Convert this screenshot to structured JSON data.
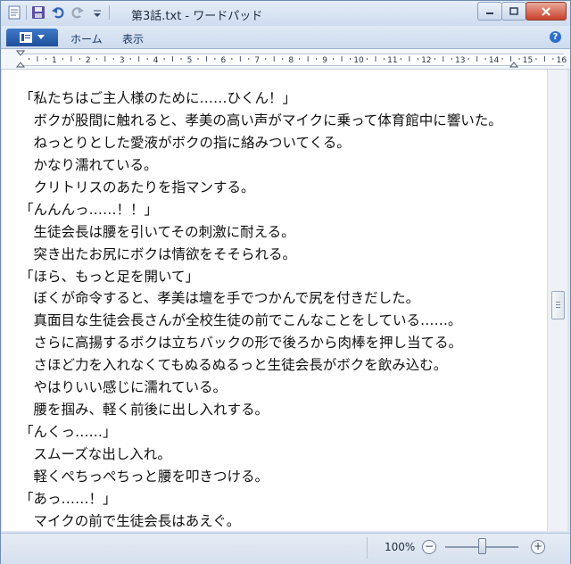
{
  "window": {
    "title": "第3話.txt - ワードパッド"
  },
  "ribbon": {
    "tabs": [
      {
        "label": "ホーム"
      },
      {
        "label": "表示"
      }
    ],
    "help": "?"
  },
  "ruler": {
    "labels": [
      "1",
      "2",
      "3",
      "4",
      "5",
      "6",
      "7",
      "8",
      "9",
      "10",
      "11",
      "12",
      "13",
      "14",
      "15",
      "16"
    ]
  },
  "document": {
    "lines": [
      "「私たちはご主人様のために……ひくん！」",
      "　ボクが股間に触れると、孝美の高い声がマイクに乗って体育館中に響いた。",
      "　ねっとりとした愛液がボクの指に絡みついてくる。",
      "　かなり濡れている。",
      "　クリトリスのあたりを指マンする。",
      "「んんんっ……！！」",
      "　生徒会長は腰を引いてその刺激に耐える。",
      "　突き出たお尻にボクは情欲をそそられる。",
      "「ほら、もっと足を開いて」",
      "　ぼくが命令すると、孝美は壇を手でつかんで尻を付きだした。",
      "　真面目な生徒会長さんが全校生徒の前でこんなことをしている……。",
      "　さらに高揚するボクは立ちバックの形で後ろから肉棒を押し当てる。",
      "　さほど力を入れなくてもぬるぬるっと生徒会長がボクを飲み込む。",
      "　やはりいい感じに濡れている。",
      "　腰を掴み、軽く前後に出し入れする。",
      "「んくっ……」",
      "　スムーズな出し入れ。",
      "　軽くぺちっぺちっと腰を叩きつける。",
      "「あっ……！」",
      "　マイクの前で生徒会長はあえぐ。"
    ]
  },
  "status": {
    "zoom_label": "100%",
    "zoom_out": "−",
    "zoom_in": "+",
    "zoom_level": 0.5
  }
}
